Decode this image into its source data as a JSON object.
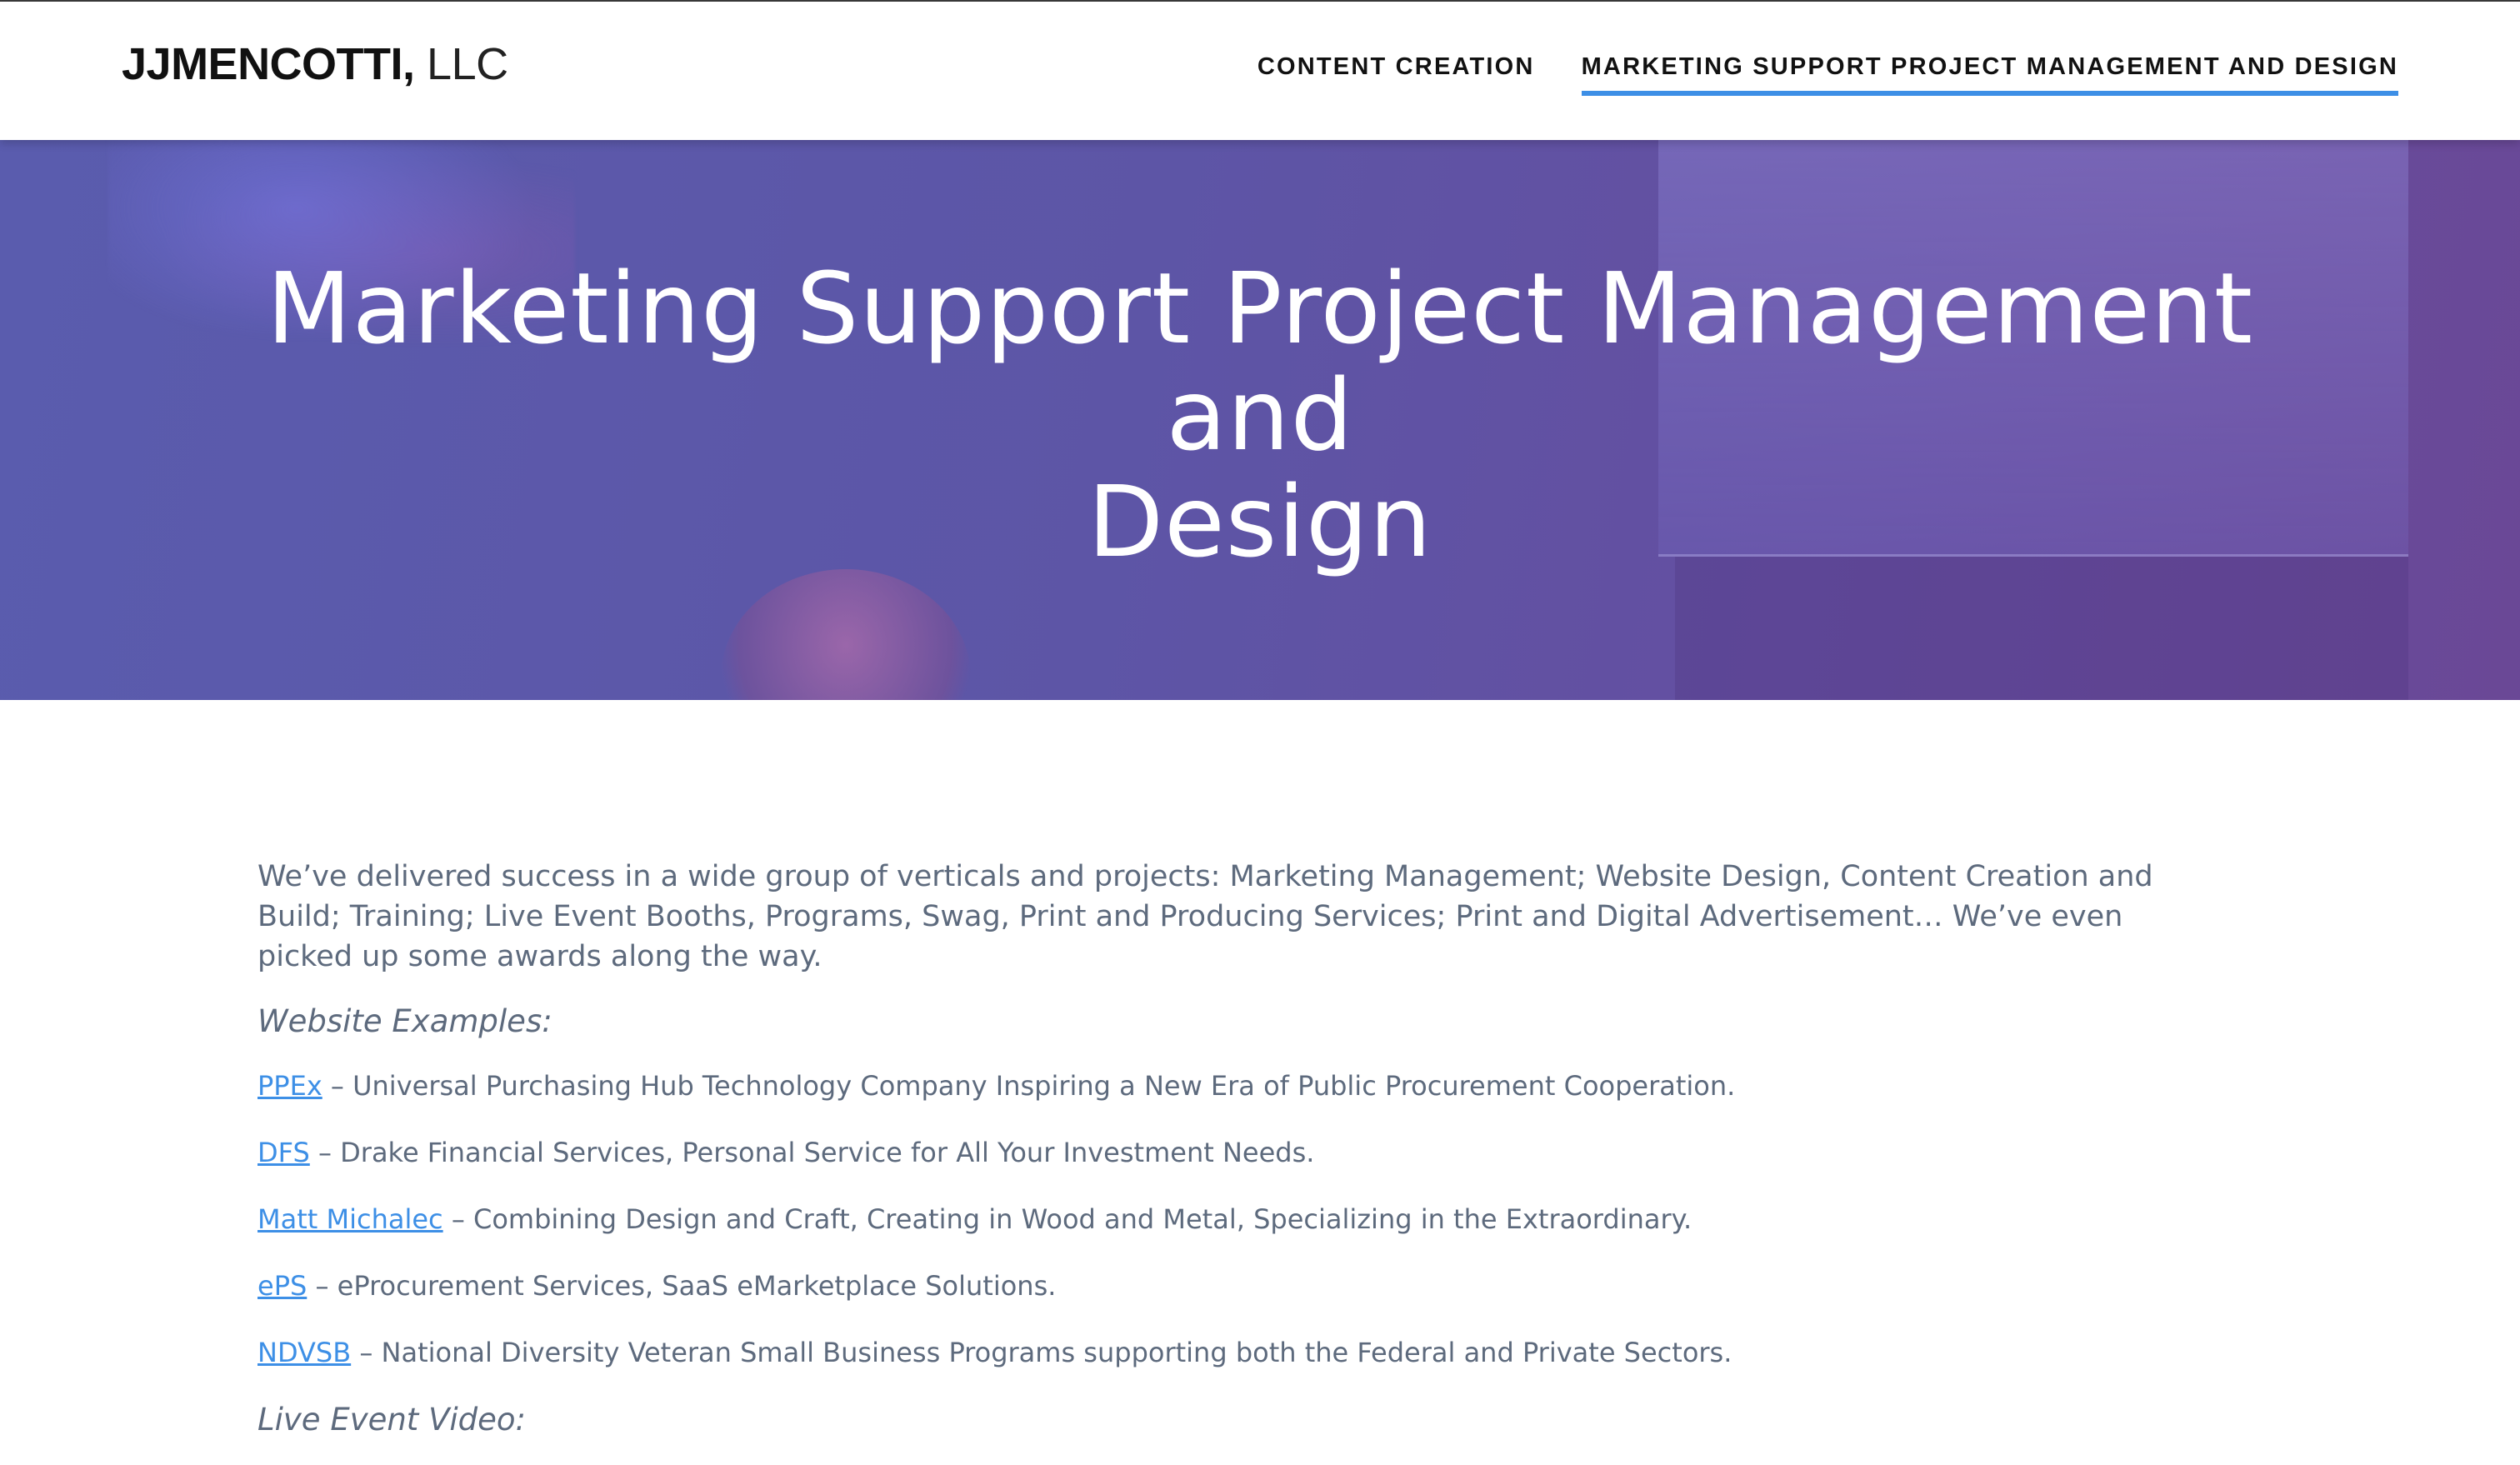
{
  "header": {
    "logo_bold": "JJMENCOTTI,",
    "logo_light": " LLC",
    "nav": [
      {
        "label": "CONTENT CREATION",
        "active": false
      },
      {
        "label": "MARKETING SUPPORT PROJECT MANAGEMENT AND DESIGN",
        "active": true
      }
    ]
  },
  "hero": {
    "title_line1": "Marketing Support Project Management and",
    "title_line2": "Design"
  },
  "content": {
    "intro": "We’ve delivered success in a wide group of verticals and projects: Marketing Management; Website Design, Content Creation and Build; Training; Live Event Booths, Programs, Swag, Print and Producing Services; Print and Digital Advertisement…   We’ve even picked up some awards along the way.",
    "website_heading": "Website Examples:",
    "examples": [
      {
        "link": "PPEx",
        "desc": " – Universal Purchasing Hub Technology Company Inspiring a New Era of Public Procurement Cooperation."
      },
      {
        "link": "DFS",
        "desc": " – Drake Financial Services, Personal Service for All Your Investment Needs."
      },
      {
        "link": "Matt Michalec",
        "desc": " – Combining Design and Craft, Creating in Wood and Metal, Specializing in the Extraordinary."
      },
      {
        "link": "ePS",
        "desc": " – eProcurement Services, SaaS eMarketplace Solutions."
      },
      {
        "link": "NDVSB",
        "desc": " – National Diversity Veteran Small Business Programs supporting both the Federal and Private Sectors."
      }
    ],
    "video_heading": "Live Event Video:"
  },
  "colors": {
    "accent": "#3d8fe6",
    "body_text": "#5d6a7d",
    "hero_overlay": "#5d55a6"
  }
}
